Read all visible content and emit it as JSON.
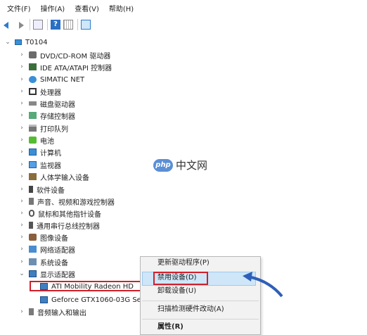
{
  "menu": [
    "文件(F)",
    "操作(A)",
    "查看(V)",
    "帮助(H)"
  ],
  "toolbar": {
    "icons": [
      "back-icon",
      "forward-icon",
      "properties-icon",
      "help-icon",
      "grid-icon",
      "monitor-icon"
    ],
    "help_glyph": "?"
  },
  "tree": {
    "root": "T0104",
    "categories": [
      "DVD/CD-ROM 驱动器",
      "IDE ATA/ATAPI 控制器",
      "SIMATIC NET",
      "处理器",
      "磁盘驱动器",
      "存储控制器",
      "打印队列",
      "电池",
      "计算机",
      "监视器",
      "人体学输入设备",
      "软件设备",
      "声音、视频和游戏控制器",
      "鼠标和其他指针设备",
      "通用串行总线控制器",
      "图像设备",
      "网络适配器",
      "系统设备",
      "显示适配器",
      "音频输入和输出"
    ],
    "display_children": [
      "ATI Mobility Radeon HD",
      "Geforce GTX1060-03G Se"
    ]
  },
  "context_menu": {
    "items": [
      "更新驱动程序(P)",
      "禁用设备(D)",
      "卸载设备(U)",
      "扫描检测硬件改动(A)",
      "属性(R)"
    ],
    "selected": "禁用设备(D)"
  },
  "watermark": {
    "logo": "php",
    "text": "中文网"
  },
  "colors": {
    "highlight_red": "#d0202b",
    "arrow_blue": "#2f5fb8",
    "selection_blue": "#cfe6f8"
  }
}
